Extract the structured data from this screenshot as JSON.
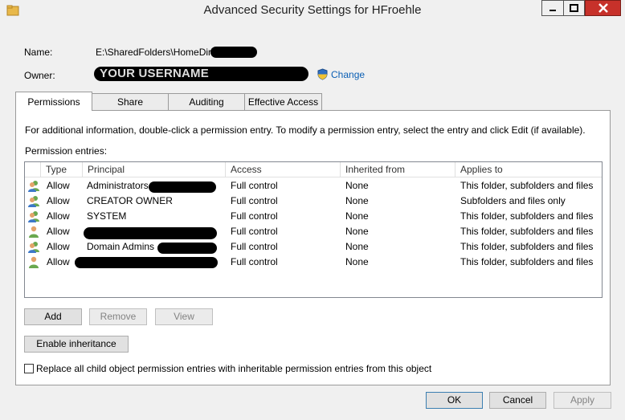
{
  "window": {
    "title": "Advanced Security Settings for HFroehle",
    "controls": [
      "minimize",
      "maximize",
      "close"
    ]
  },
  "info": {
    "name_label": "Name:",
    "name_value": "E:\\SharedFolders\\HomeDir\\",
    "owner_label": "Owner:",
    "owner_value": "YOUR USERNAME",
    "change_link": "Change"
  },
  "tabs": [
    {
      "label": "Permissions",
      "active": true
    },
    {
      "label": "Share",
      "active": false
    },
    {
      "label": "Auditing",
      "active": false
    },
    {
      "label": "Effective Access",
      "active": false
    }
  ],
  "panel": {
    "instructions": "For additional information, double-click a permission entry. To modify a permission entry, select the entry and click Edit (if available).",
    "entries_label": "Permission entries:"
  },
  "table": {
    "columns": [
      "Type",
      "Principal",
      "Access",
      "Inherited from",
      "Applies to"
    ],
    "rows": [
      {
        "icon": "group",
        "type": "Allow",
        "principal": "Administrators",
        "access": "Full control",
        "inherited": "None",
        "applies": "This folder, subfolders and files"
      },
      {
        "icon": "group",
        "type": "Allow",
        "principal": "CREATOR OWNER",
        "access": "Full control",
        "inherited": "None",
        "applies": "Subfolders and files only"
      },
      {
        "icon": "group",
        "type": "Allow",
        "principal": "SYSTEM",
        "access": "Full control",
        "inherited": "None",
        "applies": "This folder, subfolders and files"
      },
      {
        "icon": "user",
        "type": "Allow",
        "principal": "",
        "access": "Full control",
        "inherited": "None",
        "applies": "This folder, subfolders and files"
      },
      {
        "icon": "group",
        "type": "Allow",
        "principal": "Domain Admins",
        "access": "Full control",
        "inherited": "None",
        "applies": "This folder, subfolders and files"
      },
      {
        "icon": "user",
        "type": "Allow",
        "principal": "",
        "access": "Full control",
        "inherited": "None",
        "applies": "This folder, subfolders and files"
      }
    ]
  },
  "buttons": {
    "add": "Add",
    "remove": "Remove",
    "view": "View",
    "enable_inheritance": "Enable inheritance",
    "ok": "OK",
    "cancel": "Cancel",
    "apply": "Apply"
  },
  "replace_checkbox": {
    "label": "Replace all child object permission entries with inheritable permission entries from this object",
    "checked": false
  },
  "colors": {
    "link": "#0b5fb4",
    "close_button": "#c7312a",
    "window_bg": "#f0f0f0",
    "panel_bg": "#ffffff"
  }
}
